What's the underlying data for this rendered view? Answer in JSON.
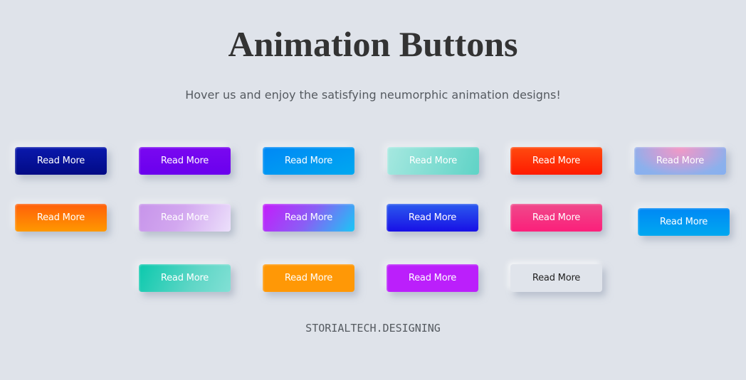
{
  "header": {
    "title": "Animation Buttons",
    "subtitle": "Hover us and enjoy the satisfying neumorphic animation designs!"
  },
  "buttons": [
    {
      "label": "Read More",
      "style": "navy-gradient",
      "colors": [
        "#0a19ad",
        "#020a85"
      ]
    },
    {
      "label": "Read More",
      "style": "violet",
      "colors": [
        "#7a08f0",
        "#6a00ee"
      ]
    },
    {
      "label": "Read More",
      "style": "sky-blue",
      "colors": [
        "#0088f5",
        "#00a8f0"
      ]
    },
    {
      "label": "Read More",
      "style": "mint-gradient",
      "colors": [
        "#a6e8e0",
        "#5fd3c6"
      ]
    },
    {
      "label": "Read More",
      "style": "red-orange",
      "colors": [
        "#ff4b0f",
        "#ff1a00"
      ]
    },
    {
      "label": "Read More",
      "style": "pink-blue-radial",
      "colors": [
        "#f099c6",
        "#86aff0"
      ]
    },
    {
      "label": "Read More",
      "style": "orange-gradient",
      "colors": [
        "#ff5f0a",
        "#ff9800"
      ]
    },
    {
      "label": "Read More",
      "style": "lavender-gradient",
      "colors": [
        "#c794ea",
        "#ece0fb"
      ]
    },
    {
      "label": "Read More",
      "style": "purple-cyan-gradient",
      "colors": [
        "#c41cfb",
        "#1ac7f5"
      ]
    },
    {
      "label": "Read More",
      "style": "royal-blue",
      "colors": [
        "#2b5aee",
        "#1810e6"
      ]
    },
    {
      "label": "Read More",
      "style": "hot-pink",
      "colors": [
        "#ef4a8b",
        "#fb1f7a"
      ]
    },
    {
      "label": "Read More",
      "style": "sky-blue-raised",
      "colors": [
        "#0088f5",
        "#00a8f0"
      ]
    },
    {
      "label": "Read More",
      "style": "teal-gradient",
      "colors": [
        "#0bc9ad",
        "#82e0d5"
      ]
    },
    {
      "label": "Read More",
      "style": "amber",
      "colors": [
        "#ff9806"
      ]
    },
    {
      "label": "Read More",
      "style": "magenta",
      "colors": [
        "#bb1ffb"
      ]
    },
    {
      "label": "Read More",
      "style": "neumorphic-light",
      "colors": [
        "#e0e4eb"
      ]
    }
  ],
  "footer": {
    "credit": "STORIALTECH.DESIGNING"
  },
  "theme": {
    "background": "#dfe3ea",
    "heading_color": "#333333",
    "text_color": "#555a60"
  }
}
